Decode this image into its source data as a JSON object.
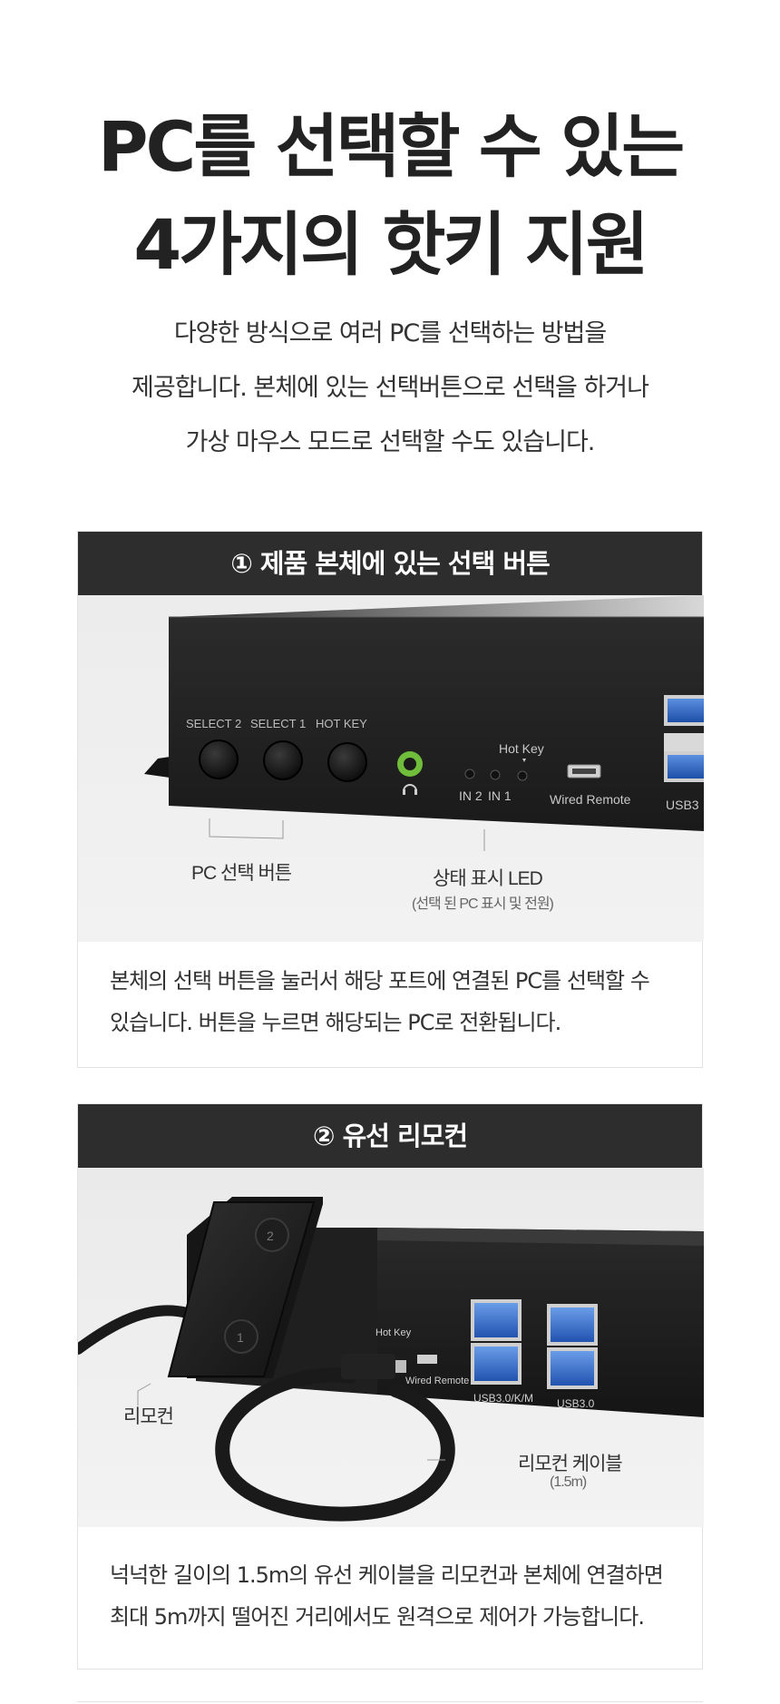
{
  "hero": {
    "title_line1": "PC를 선택할 수 있는",
    "title_line2": "4가지의 핫키 지원",
    "desc_line1": "다양한 방식으로 여러  PC를 선택하는 방법을",
    "desc_line2": "제공합니다. 본체에 있는 선택버튼으로 선택을 하거나",
    "desc_line3": "가상 마우스 모드로 선택할 수도 있습니다."
  },
  "card1": {
    "header": "① 제품 본체에 있는 선택 버튼",
    "device": {
      "button1": "SELECT 2",
      "button2": "SELECT 1",
      "button3": "HOT KEY",
      "hotkey_led": "Hot Key",
      "in2": "IN 2",
      "in1": "IN 1",
      "wired_remote": "Wired Remote",
      "usb": "USB3"
    },
    "callout_pc": "PC 선택 버튼",
    "callout_led": "상태 표시 LED",
    "callout_led_sub": "(선택 된 PC 표시 및 전원)",
    "text_line1": "본체의 선택 버튼을 눌러서 해당 포트에 연결된 PC를 선택할 수",
    "text_line2": "있습니다. 버튼을 누르면 해당되는 PC로 전환됩니다."
  },
  "card2": {
    "header": "② 유선 리모컨",
    "device": {
      "remote_btn2": "2",
      "remote_btn1": "1",
      "hotkey": "Hot Key",
      "wired_remote": "Wired Remote",
      "usb_km": "USB3.0/K/M",
      "usb": "USB3.0"
    },
    "callout_remote": "리모컨",
    "callout_cable": "리모컨 케이블",
    "callout_cable_sub": "(1.5m)",
    "text_line1": "넉넉한 길이의 1.5m의 유선 케이블을 리모컨과 본체에 연결하면",
    "text_line2": "최대 5m까지 떨어진 거리에서도 원격으로 제어가 가능합니다."
  }
}
